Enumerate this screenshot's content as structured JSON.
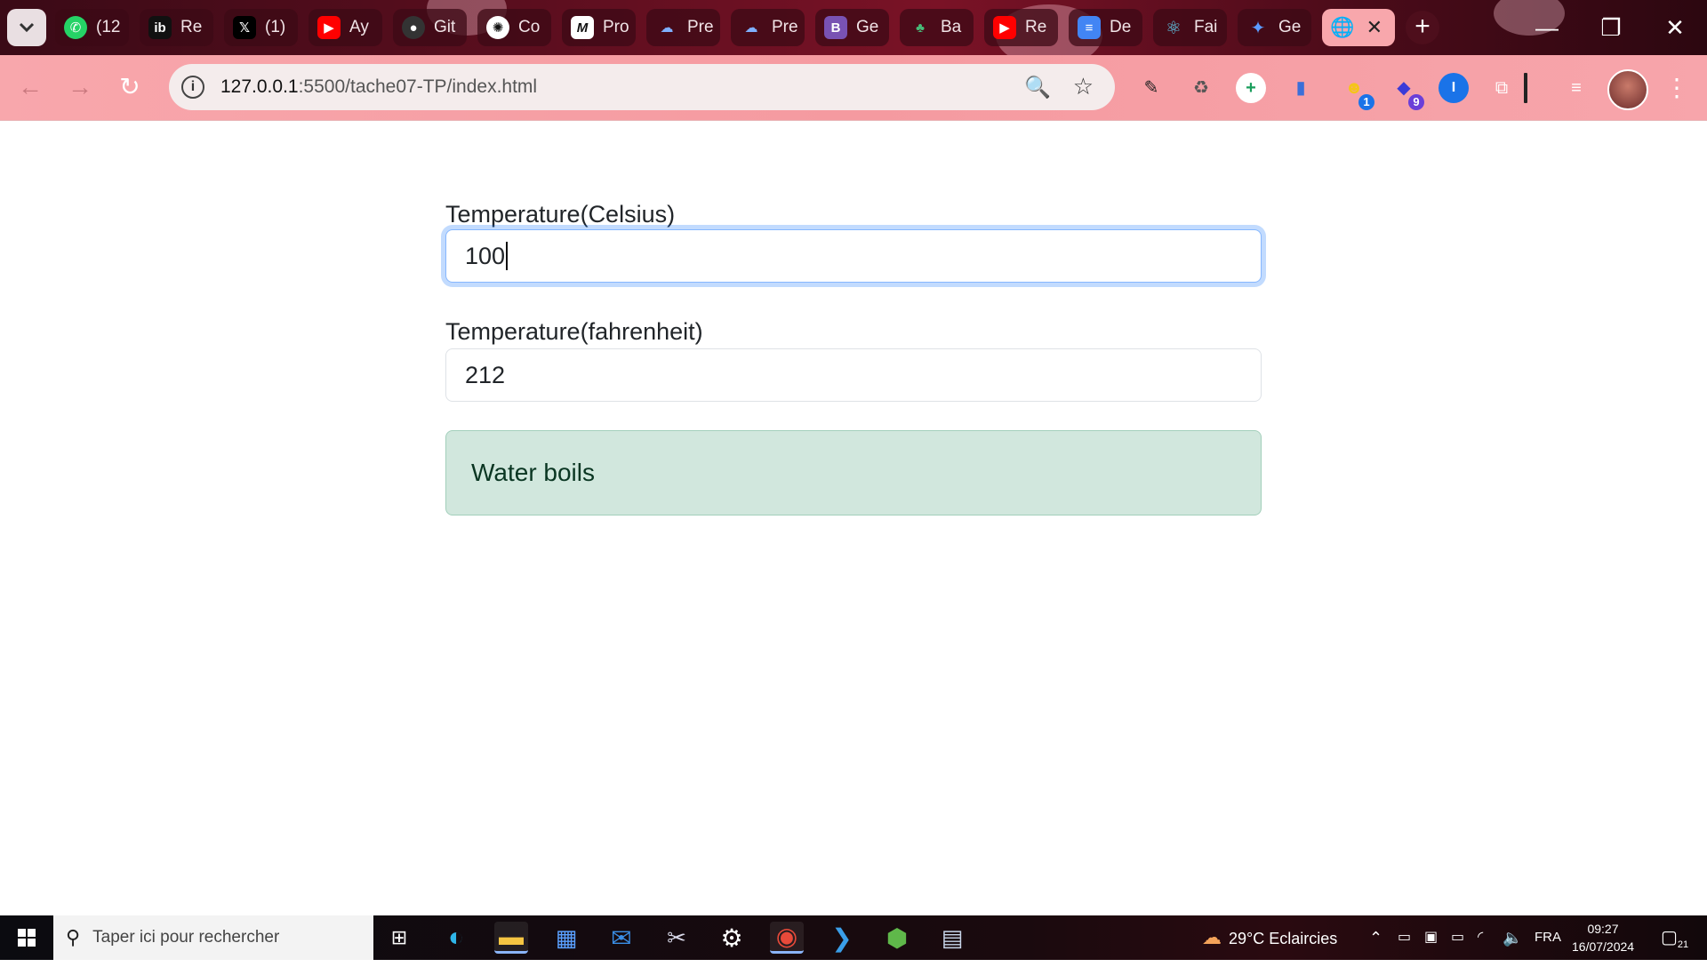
{
  "browser": {
    "tabs": [
      {
        "title": "(12",
        "icon": "whatsapp-icon",
        "color": "#25d366"
      },
      {
        "title": "Re",
        "icon": "ib-icon",
        "color": "#111111"
      },
      {
        "title": "(1)",
        "icon": "x-icon",
        "color": "#000000"
      },
      {
        "title": "Ay",
        "icon": "youtube-icon",
        "color": "#ff0000"
      },
      {
        "title": "Git",
        "icon": "github-icon",
        "color": "#333333"
      },
      {
        "title": "Co",
        "icon": "chatgpt-icon",
        "color": "#111111"
      },
      {
        "title": "Pro",
        "icon": "m-icon",
        "color": "#111111"
      },
      {
        "title": "Pre",
        "icon": "cloud-icon",
        "color": "#2b6cb0"
      },
      {
        "title": "Pre",
        "icon": "cloud-icon",
        "color": "#2b6cb0"
      },
      {
        "title": "Ge",
        "icon": "bootstrap-icon",
        "color": "#7952b3"
      },
      {
        "title": "Ba",
        "icon": "plant-icon",
        "color": "#2f855a"
      },
      {
        "title": "Re",
        "icon": "youtube-icon",
        "color": "#ff0000"
      },
      {
        "title": "De",
        "icon": "docs-icon",
        "color": "#4285f4"
      },
      {
        "title": "Fai",
        "icon": "react-icon",
        "color": "#61dafb"
      },
      {
        "title": "Ge",
        "icon": "gemini-icon",
        "color": "#4f8ef7"
      }
    ],
    "active_tab": {
      "icon": "globe-icon",
      "close": "✕"
    },
    "new_tab": "+",
    "window_controls": {
      "minimize": "—",
      "restore": "❐",
      "close": "✕"
    },
    "url": {
      "host": "127.0.0.1",
      "path": ":5500/tache07-TP/index.html"
    },
    "extensions": [
      {
        "icon": "eyedropper-icon",
        "badge": ""
      },
      {
        "icon": "recycle-icon",
        "badge": ""
      },
      {
        "icon": "plus-circle-icon",
        "badge": ""
      },
      {
        "icon": "clipboard-icon",
        "badge": ""
      },
      {
        "icon": "emoji-icon",
        "badge": "1"
      },
      {
        "icon": "graduation-icon",
        "badge": "9"
      },
      {
        "icon": "password-icon",
        "badge": ""
      },
      {
        "icon": "puzzle-icon",
        "badge": ""
      },
      {
        "icon": "media-queue-icon",
        "badge": ""
      }
    ]
  },
  "form": {
    "celsius_label": "Temperature(Celsius)",
    "celsius_value": "100",
    "fahrenheit_label": "Temperature(fahrenheit)",
    "fahrenheit_value": "212",
    "status_message": "Water boils"
  },
  "taskbar": {
    "search_placeholder": "Taper ici pour rechercher",
    "weather": "29°C  Eclaircies",
    "language": "FRA",
    "time": "09:27",
    "date": "16/07/2024",
    "notifications": "21"
  },
  "colors": {
    "alert_bg": "#d1e7dd",
    "alert_text": "#0a3622",
    "focus_ring": "#86b7fe",
    "toolbar_pink": "#f8a7ac"
  }
}
